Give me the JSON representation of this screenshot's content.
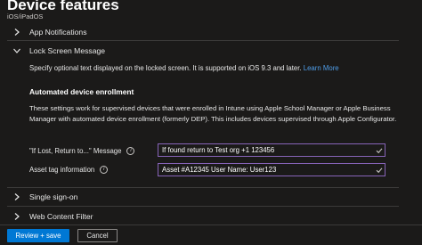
{
  "header": {
    "title": "Device features",
    "subtitle": "iOS/iPadOS",
    "more_icon": "more-icon"
  },
  "sections": {
    "app_notifications": {
      "label": "App Notifications",
      "expanded": false
    },
    "lock_screen": {
      "label": "Lock Screen Message",
      "expanded": true,
      "description": "Specify optional text displayed on the locked screen. It is supported on iOS 9.3 and later.",
      "learn_more": "Learn More",
      "subheading": "Automated device enrollment",
      "paragraph": "These settings work for supervised devices that were enrolled in Intune using Apple School Manager or Apple Business Manager with automated device enrollment (formerly DEP). This includes devices supervised through Apple Configurator.",
      "fields": [
        {
          "label": "\"If Lost, Return to...\" Message",
          "value": "If found return to Test org +1 123456"
        },
        {
          "label": "Asset tag information",
          "value": "Asset #A12345 User Name: User123"
        }
      ]
    },
    "single_sign_on": {
      "label": "Single sign-on",
      "expanded": false
    },
    "web_content_filter": {
      "label": "Web Content Filter",
      "expanded": false
    }
  },
  "footer": {
    "primary_label": "Review + save",
    "secondary_label": "Cancel"
  },
  "colors": {
    "accent": "#0078d4",
    "input_border": "#8764b8",
    "link": "#4f9de8",
    "background": "#1b1a19"
  }
}
